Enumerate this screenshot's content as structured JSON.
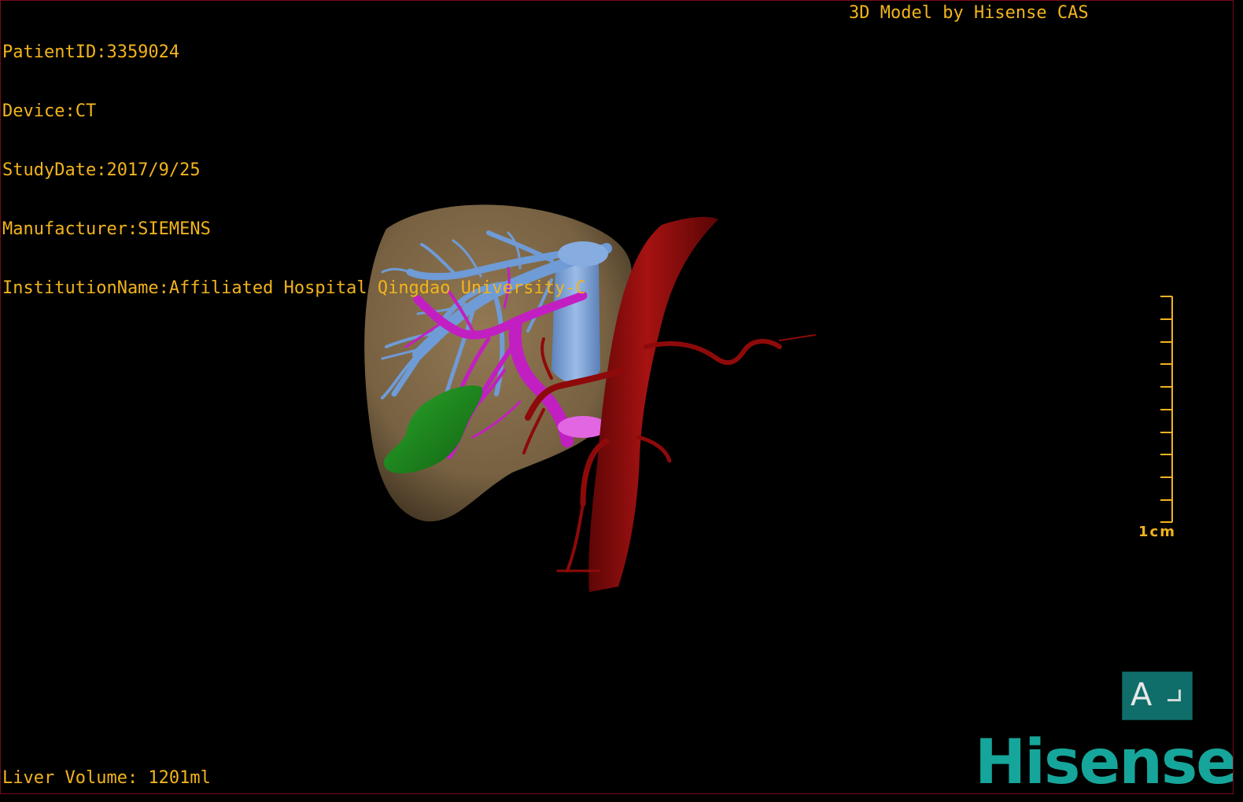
{
  "meta": {
    "patient_id": "PatientID:3359024",
    "device": "Device:CT",
    "study_date": "StudyDate:2017/9/25",
    "manufacturer": "Manufacturer:SIEMENS",
    "institution": "InstitutionName:Affiliated Hospital Qingdao University-C"
  },
  "brand_caption": "3D Model by Hisense CAS",
  "liver_volume": "Liver Volume: 1201ml",
  "scale_bar": {
    "label": "1cm"
  },
  "orientation": {
    "label": "A"
  },
  "logo": {
    "text": "Hisense",
    "color": "#16a59a"
  },
  "colors": {
    "overlay_text": "#f2b41c",
    "liver": "#7d6645",
    "hepatic_veins": "#6f9bd6",
    "portal_vein": "#c21fc2",
    "artery": "#8e0a0a",
    "tumor": "#1f8f1f",
    "cube": "#0f6e6a"
  }
}
